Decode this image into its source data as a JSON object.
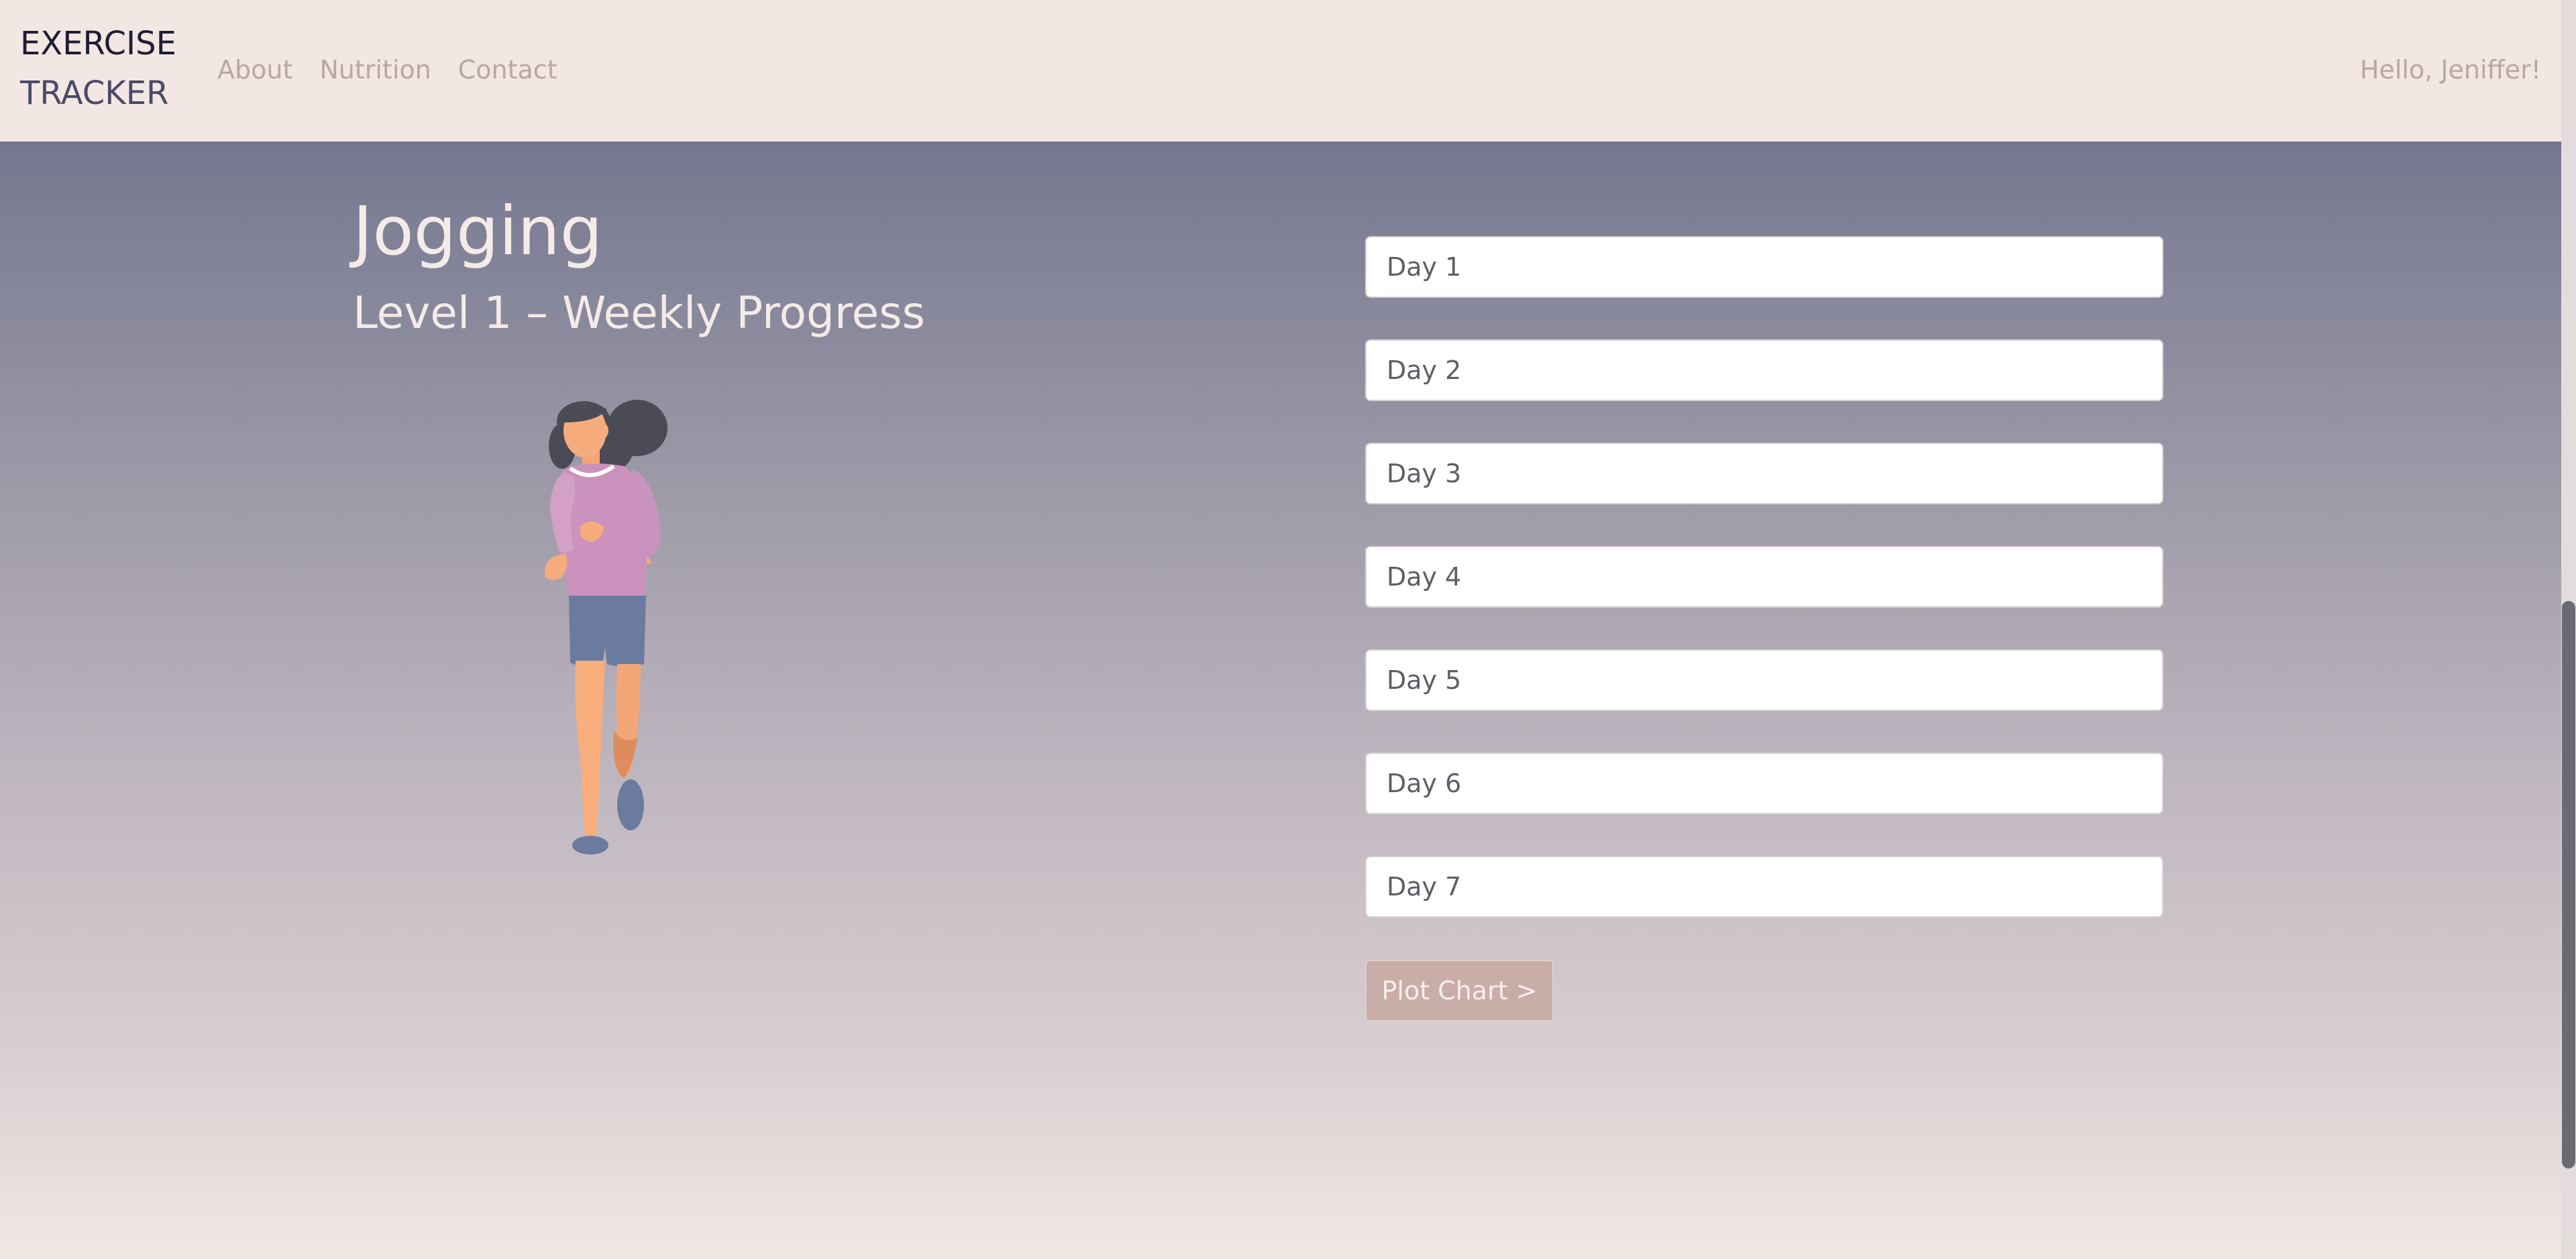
{
  "navbar": {
    "brand_line1": "EXERCISE",
    "brand_line2": "TRACKER",
    "links": [
      "About",
      "Nutrition",
      "Contact"
    ],
    "greeting": "Hello, Jeniffer!"
  },
  "main": {
    "title": "Jogging",
    "subtitle": "Level 1 – Weekly Progress",
    "illustration_icon": "jogging-woman-illustration"
  },
  "form": {
    "days": [
      "Day 1",
      "Day 2",
      "Day 3",
      "Day 4",
      "Day 5",
      "Day 6",
      "Day 7"
    ],
    "plot_button_label": "Plot Chart >"
  },
  "colors": {
    "navbar_bg": "#f2e7e3",
    "gradient_top": "#626580",
    "gradient_bottom": "#f2e7e3",
    "button_bg": "#c9ada8",
    "heading_text": "#f4ebe8",
    "nav_link": "#b9a7a4"
  }
}
